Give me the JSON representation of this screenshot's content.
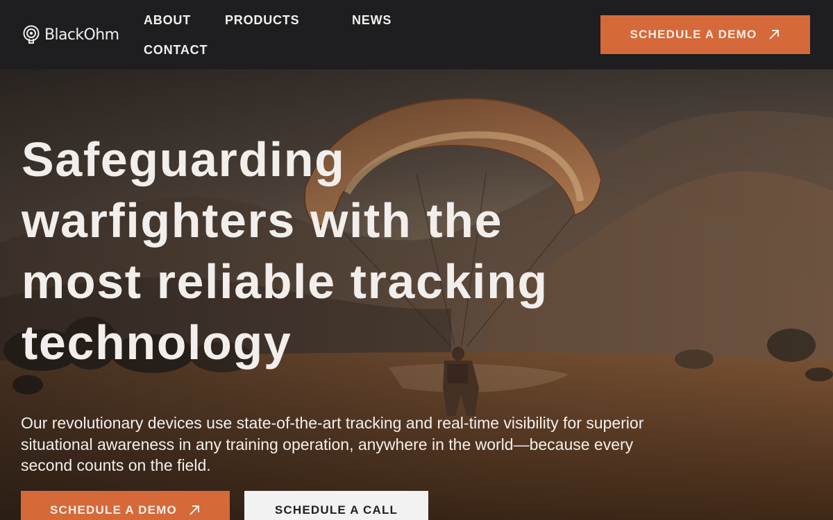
{
  "brand": {
    "name": "BlackOhm",
    "logo_icon": "signal-pin-icon"
  },
  "nav": {
    "about": "ABOUT",
    "products": "PRODUCTS",
    "news": "NEWS",
    "contact": "CONTACT"
  },
  "header_cta": {
    "label": "SCHEDULE A DEMO",
    "icon": "arrow-up-right-icon"
  },
  "hero": {
    "title": "Safeguarding warfighters with the most reliable tracking technology",
    "subtitle": "Our revolutionary devices use state-of-the-art tracking and real-time visibility for superior situational awareness in any training operation, anywhere in the world—because every second counts on the field.",
    "primary_cta": {
      "label": "SCHEDULE A DEMO",
      "icon": "arrow-up-right-icon"
    },
    "secondary_cta": {
      "label": "SCHEDULE A CALL"
    },
    "image": "paratrooper-landing-photo"
  },
  "colors": {
    "header_bg": "#1e1d20",
    "accent": "#d5693a",
    "text_light": "#f1eeeb",
    "secondary_button_bg": "#f2f2f2"
  }
}
